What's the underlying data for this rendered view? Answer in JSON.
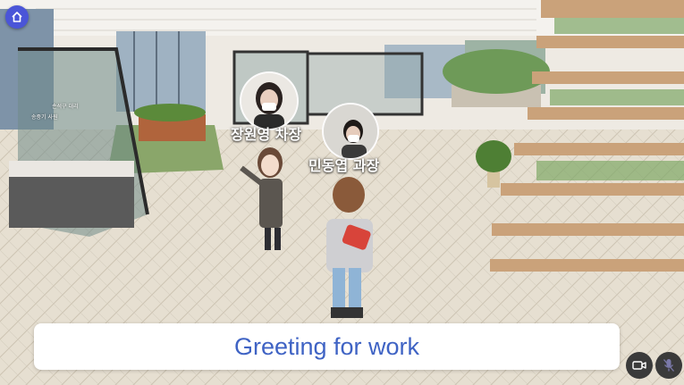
{
  "toolbar": {
    "home_icon": "home-icon"
  },
  "participants": [
    {
      "name": "장원영 차장",
      "icon": "user-video-feed"
    },
    {
      "name": "민동엽 과장",
      "icon": "user-video-feed"
    }
  ],
  "booth_labels": [
    "손석구 대리",
    "송중기 사원"
  ],
  "caption": {
    "text": "Greeting for work"
  },
  "controls": {
    "camera_icon": "video-camera-icon",
    "mic_icon": "microphone-icon"
  },
  "colors": {
    "home_button": "#4a55d8",
    "caption_text": "#3f63c4",
    "control_bg": "#3a3a3a",
    "mic_muted": "#7a78a8"
  }
}
